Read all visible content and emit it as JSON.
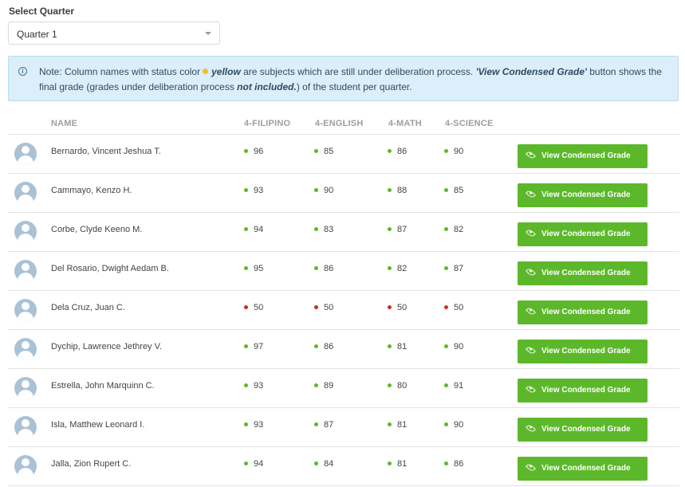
{
  "filter": {
    "label": "Select Quarter",
    "selected": "Quarter 1"
  },
  "note": {
    "part1": "Note: Column names with status color",
    "yellow_word": "yellow",
    "part2": " are subjects which are still under deliberation process. ",
    "button_ref": "'View Condensed Grade'",
    "part3": " button shows the final grade (grades under deliberation process ",
    "not_included": "not included.",
    "part4": ") of the student per quarter."
  },
  "columns": [
    "NAME",
    "4-FILIPINO",
    "4-ENGLISH",
    "4-MATH",
    "4-SCIENCE"
  ],
  "button_label": "View Condensed Grade",
  "colors": {
    "pass": "#5cb82a",
    "fail": "#cc2b2b",
    "deliberation": "#f2c21a",
    "button": "#5cb82a"
  },
  "students": [
    {
      "name": "Bernardo, Vincent Jeshua T.",
      "grades": [
        96,
        85,
        86,
        90
      ],
      "status": [
        "pass",
        "pass",
        "pass",
        "pass"
      ]
    },
    {
      "name": "Cammayo, Kenzo H.",
      "grades": [
        93,
        90,
        88,
        85
      ],
      "status": [
        "pass",
        "pass",
        "pass",
        "pass"
      ]
    },
    {
      "name": "Corbe, Clyde Keeno M.",
      "grades": [
        94,
        83,
        87,
        82
      ],
      "status": [
        "pass",
        "pass",
        "pass",
        "pass"
      ]
    },
    {
      "name": "Del Rosario, Dwight Aedam B.",
      "grades": [
        95,
        86,
        82,
        87
      ],
      "status": [
        "pass",
        "pass",
        "pass",
        "pass"
      ]
    },
    {
      "name": "Dela Cruz, Juan C.",
      "grades": [
        50,
        50,
        50,
        50
      ],
      "status": [
        "fail",
        "fail",
        "fail",
        "fail"
      ]
    },
    {
      "name": "Dychip, Lawrence Jethrey V.",
      "grades": [
        97,
        86,
        81,
        90
      ],
      "status": [
        "pass",
        "pass",
        "pass",
        "pass"
      ]
    },
    {
      "name": "Estrella, John Marquinn C.",
      "grades": [
        93,
        89,
        80,
        91
      ],
      "status": [
        "pass",
        "pass",
        "pass",
        "pass"
      ]
    },
    {
      "name": "Isla, Matthew Leonard I.",
      "grades": [
        93,
        87,
        81,
        90
      ],
      "status": [
        "pass",
        "pass",
        "pass",
        "pass"
      ]
    },
    {
      "name": "Jalla, Zion Rupert C.",
      "grades": [
        94,
        84,
        81,
        86
      ],
      "status": [
        "pass",
        "pass",
        "pass",
        "pass"
      ]
    }
  ]
}
